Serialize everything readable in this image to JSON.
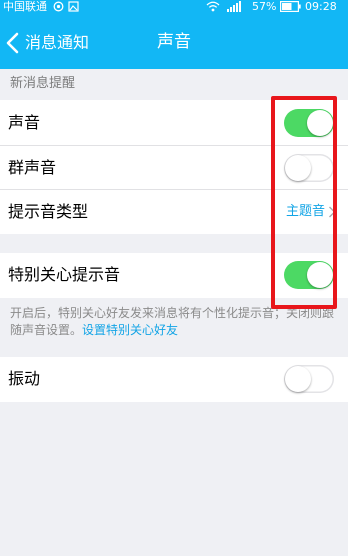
{
  "status_bar": {
    "carrier": "中国联通",
    "battery_percent": "57%",
    "time": "09:28"
  },
  "nav": {
    "back_label": "消息通知",
    "title": "声音"
  },
  "section_new_messages": {
    "header": "新消息提醒",
    "rows": [
      {
        "label": "声音",
        "switch_on": true
      },
      {
        "label": "群声音",
        "switch_on": false
      },
      {
        "label": "提示音类型",
        "value": "主题音"
      }
    ]
  },
  "special_care": {
    "label": "特别关心提示音",
    "switch_on": true,
    "footnote": "开启后，特别关心好友发来消息将有个性化提示音；关闭则跟随声音设置。",
    "footnote_link": "设置特别关心好友"
  },
  "vibration": {
    "label": "振动",
    "switch_on": false
  },
  "colors": {
    "header_bg": "#12b7f5",
    "switch_on": "#4cd964",
    "link": "#12a4e6",
    "highlight_border": "#e8161b",
    "page_bg": "#eff0f4"
  }
}
